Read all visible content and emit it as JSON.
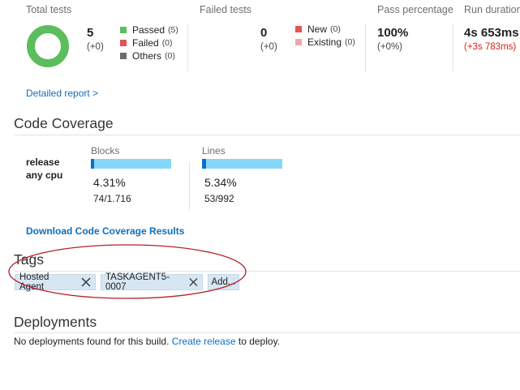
{
  "summary": {
    "total": {
      "label": "Total tests",
      "count": "5",
      "delta": "(+0)"
    },
    "legend_total": [
      {
        "label": "Passed",
        "count": "(5)",
        "color": "#5cbd5c"
      },
      {
        "label": "Failed",
        "count": "(0)",
        "color": "#e05454"
      },
      {
        "label": "Others",
        "count": "(0)",
        "color": "#6d6d6d"
      }
    ],
    "failed": {
      "label": "Failed tests",
      "count": "0",
      "delta": "(+0)"
    },
    "legend_failed": [
      {
        "label": "New",
        "count": "(0)",
        "color": "#e05454"
      },
      {
        "label": "Existing",
        "count": "(0)",
        "color": "#f2a6a6"
      }
    ],
    "pass": {
      "label": "Pass percentage",
      "value": "100%",
      "delta": "(+0%)"
    },
    "duration": {
      "label": "Run duration",
      "value": "4s 653ms",
      "delta": "(+3s 783ms)",
      "delta_color": "#d9221c"
    },
    "detailed_link": "Detailed report >"
  },
  "coverage": {
    "title": "Code Coverage",
    "config_line1": "release",
    "config_line2": "any cpu",
    "blocks": {
      "label": "Blocks",
      "percent": "4.31%",
      "ratio": "74/1.716",
      "fill_fraction": 0.0431
    },
    "lines": {
      "label": "Lines",
      "percent": "5.34%",
      "ratio": "53/992",
      "fill_fraction": 0.0534
    },
    "download_link": "Download Code Coverage Results"
  },
  "tags": {
    "title": "Tags",
    "items": [
      "Hosted Agent",
      "TASKAGENT5-0007"
    ],
    "add_label": "Add..."
  },
  "deployments": {
    "title": "Deployments",
    "message_prefix": "No deployments found for this build.",
    "create_link": "Create release",
    "message_suffix": "to deploy."
  },
  "colors": {
    "accent": "#106ebe",
    "donut": "#5cbd5c",
    "highlight_ellipse": "#b4202a"
  }
}
